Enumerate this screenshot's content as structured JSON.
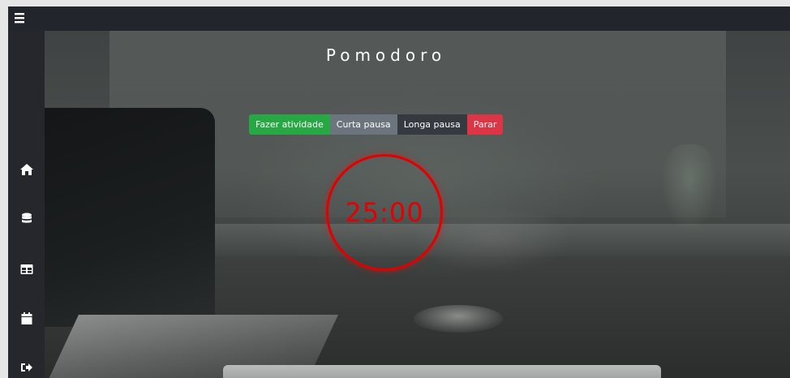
{
  "app": {
    "title": "Pomodoro"
  },
  "topbar": {
    "menu_icon": "hamburger-menu-icon"
  },
  "sidebar": {
    "items": [
      {
        "icon": "home-icon"
      },
      {
        "icon": "database-icon"
      },
      {
        "icon": "table-icon"
      },
      {
        "icon": "calendar-icon"
      },
      {
        "icon": "sign-out-icon"
      }
    ]
  },
  "controls": {
    "activity_label": "Fazer atividade",
    "short_break_label": "Curta pausa",
    "long_break_label": "Longa pausa",
    "stop_label": "Parar"
  },
  "timer": {
    "display": "25:00"
  },
  "colors": {
    "activity": "#28a745",
    "short_break": "#6c757d",
    "long_break": "#343a40",
    "stop": "#dc3545",
    "timer": "#e00000"
  }
}
